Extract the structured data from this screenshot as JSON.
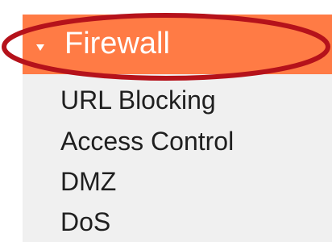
{
  "menu": {
    "title": "Firewall",
    "expanded": true,
    "header_color": "#ff7b45",
    "items": [
      {
        "label": "URL Blocking"
      },
      {
        "label": "Access Control"
      },
      {
        "label": "DMZ"
      },
      {
        "label": "DoS"
      }
    ]
  },
  "annotation": {
    "shape": "ellipse",
    "color": "#b5121b"
  }
}
